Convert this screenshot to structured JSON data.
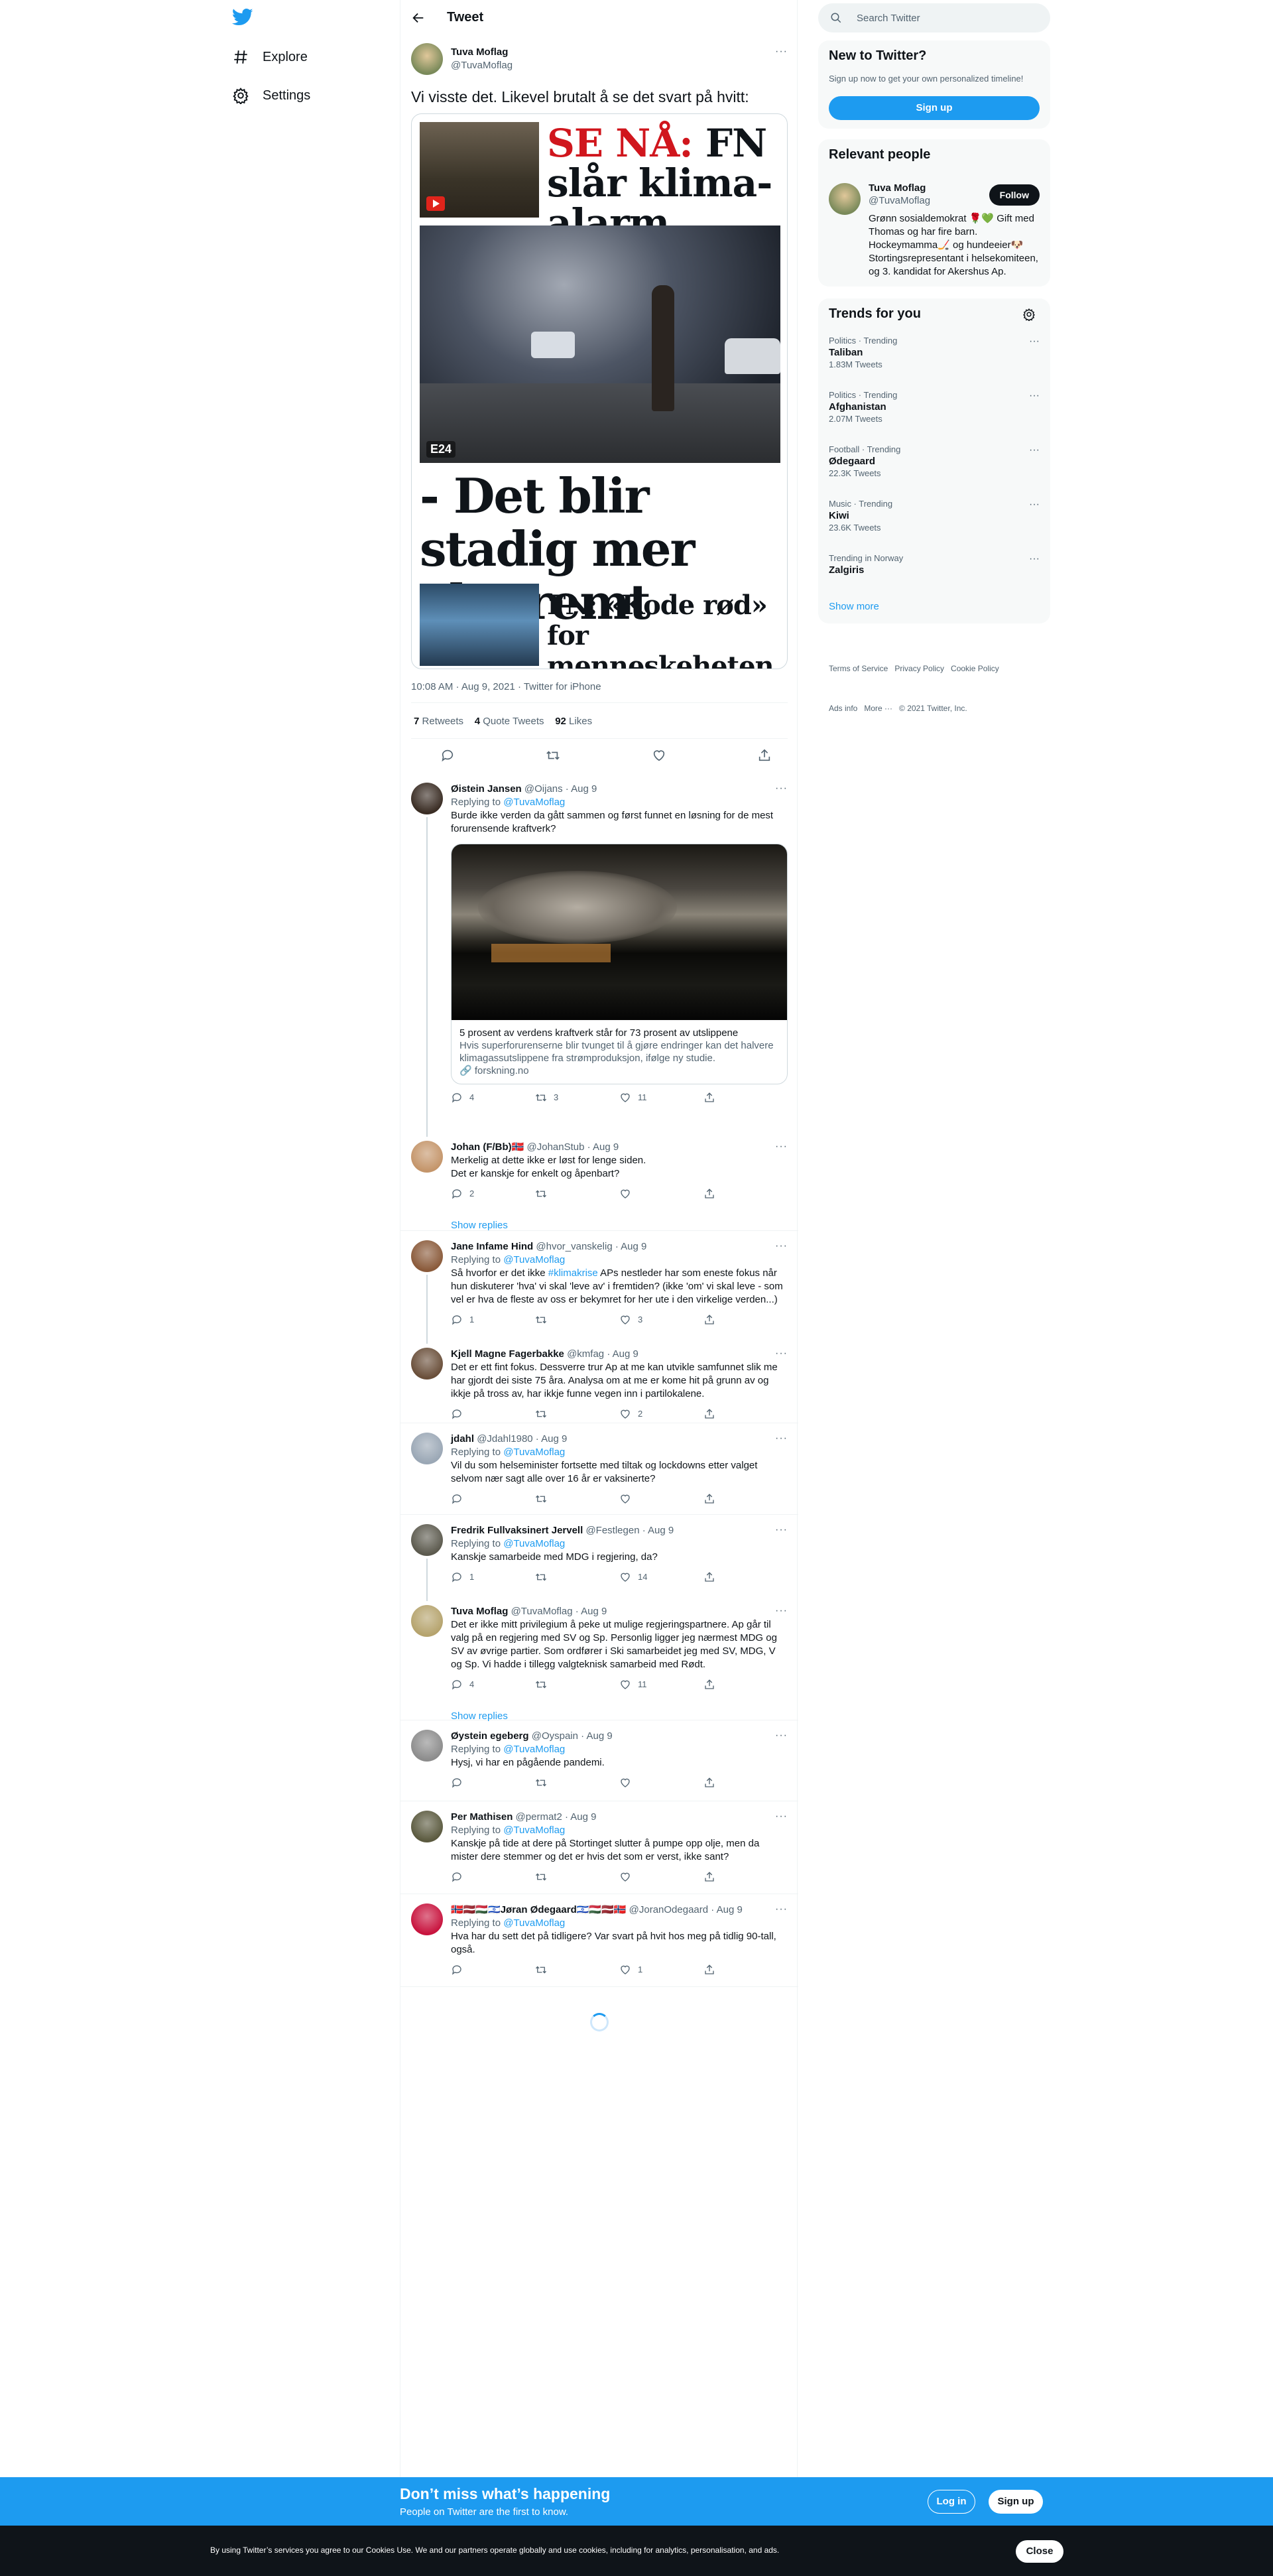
{
  "nav": {
    "explore": "Explore",
    "settings": "Settings"
  },
  "header": {
    "title": "Tweet"
  },
  "tweet": {
    "name": "Tuva Moflag",
    "handle": "@TuvaMoflag",
    "text": "Vi visste det. Likevel brutalt å se det svart på hvitt:",
    "headline1_red": "SE NÅ:",
    "headline1_rest": "FN slår klima-alarm",
    "badge": "E24",
    "headline2": "- Det blir stadig mer ekstremt",
    "headline3": "FN: «Kode rød» for menneskeheten",
    "meta": "10:08 AM · Aug 9, 2021 · Twitter for iPhone",
    "retweets": "7",
    "retweets_label": "Retweets",
    "quotes": "4",
    "quotes_label": "Quote Tweets",
    "likes": "92",
    "likes_label": "Likes"
  },
  "replies": [
    {
      "name": "Øistein Jansen",
      "handle": "@Oijans · Aug 9",
      "replying": "Replying to",
      "to": "@TuvaMoflag",
      "text": "Burde ikke verden da gått sammen og først funnet en løsning for de mest forurensende kraftverk?",
      "reply": "4",
      "rt": "3",
      "like": "11",
      "card": {
        "title": "5 prosent av verdens kraftverk står for 73 prosent av utslippene",
        "desc": "Hvis superforurenserne blir tvunget til å gjøre endringer kan det halvere klimagassutslippene fra strømproduksjon, ifølge ny studie.",
        "domain": "forskning.no"
      }
    },
    {
      "name": "Johan (F/Bb)🇳🇴",
      "handle": "@JohanStub · Aug 9",
      "text": "Merkelig at dette ikke er løst for lenge siden.\nDet er kanskje for enkelt og åpenbart?",
      "reply": "2",
      "rt": "",
      "like": "",
      "show": "Show replies"
    },
    {
      "name": "Jane Infame Hind",
      "handle": "@hvor_vanskelig · Aug 9",
      "replying": "Replying to",
      "to": "@TuvaMoflag",
      "text_a": "Så hvorfor er det ikke ",
      "tag": "#klimakrise",
      "text_b": " APs nestleder har som eneste fokus når hun diskuterer 'hva' vi skal 'leve av' i fremtiden? (ikke 'om' vi skal leve - som vel er hva de fleste av oss er bekymret for her ute i den virkelige verden...)",
      "reply": "1",
      "rt": "",
      "like": "3"
    },
    {
      "name": "Kjell Magne Fagerbakke",
      "handle": "@kmfag · Aug 9",
      "text": "Det er ett fint fokus. Dessverre trur Ap at me kan utvikle samfunnet slik me har gjordt dei siste 75 åra. Analysa om at me er kome hit på grunn av og ikkje på tross av, har ikkje funne vegen inn i partilokalene.",
      "reply": "",
      "rt": "",
      "like": "2"
    },
    {
      "name": "jdahl",
      "handle": "@Jdahl1980 · Aug 9",
      "replying": "Replying to",
      "to": "@TuvaMoflag",
      "text": "Vil du som helseminister fortsette med tiltak og lockdowns etter valget selvom nær sagt alle over 16 år er vaksinerte?",
      "reply": "",
      "rt": "",
      "like": ""
    },
    {
      "name": "Fredrik Fullvaksinert Jervell",
      "handle": "@Festlegen · Aug 9",
      "replying": "Replying to",
      "to": "@TuvaMoflag",
      "text": "Kanskje samarbeide med MDG i regjering, da?",
      "reply": "1",
      "rt": "",
      "like": "14"
    },
    {
      "name": "Tuva Moflag",
      "handle": "@TuvaMoflag · Aug 9",
      "text": "Det er ikke mitt privilegium å peke ut mulige regjeringspartnere. Ap går til valg på en regjering med SV og Sp. Personlig ligger jeg nærmest MDG og SV av øvrige partier. Som ordfører i Ski samarbeidet jeg med SV, MDG, V og Sp. Vi hadde i tillegg valgteknisk samarbeid med Rødt.",
      "reply": "4",
      "rt": "",
      "like": "11",
      "show": "Show replies"
    },
    {
      "name": "Øystein egeberg",
      "handle": "@Oyspain · Aug 9",
      "replying": "Replying to",
      "to": "@TuvaMoflag",
      "text": "Hysj, vi har en pågående pandemi.",
      "reply": "",
      "rt": "",
      "like": ""
    },
    {
      "name": "Per Mathisen",
      "handle": "@permat2 · Aug 9",
      "replying": "Replying to",
      "to": "@TuvaMoflag",
      "text": "Kanskje på tide at dere på Stortinget slutter å pumpe opp olje, men da mister dere stemmer og det er hvis det som er verst, ikke sant?",
      "reply": "",
      "rt": "",
      "like": ""
    },
    {
      "name": "🇳🇴🇱🇻🇭🇺🇮🇱Jøran Ødegaard🇮🇱🇭🇺🇱🇻🇳🇴",
      "handle": "@JoranOdegaard · Aug 9",
      "replying": "Replying to",
      "to": "@TuvaMoflag",
      "text": "Hva har du sett det på tidligere? Var svart på hvit hos meg på tidlig 90-tall, også.",
      "reply": "",
      "rt": "",
      "like": "1"
    }
  ],
  "search": {
    "placeholder": "Search Twitter"
  },
  "new": {
    "title": "New to Twitter?",
    "sub": "Sign up now to get your own personalized timeline!",
    "btn": "Sign up"
  },
  "relevant": {
    "title": "Relevant people",
    "name": "Tuva Moflag",
    "handle": "@TuvaMoflag",
    "follow": "Follow",
    "bio": "Grønn sosialdemokrat 🌹💚 Gift med Thomas og har fire barn. Hockeymamma🏒 og hundeeier🐶 Stortingsrepresentant i helsekomiteen, og 3. kandidat for Akershus Ap."
  },
  "trends": {
    "title": "Trends for you",
    "items": [
      {
        "c": "Politics · Trending",
        "t": "Taliban",
        "n": "1.83M Tweets"
      },
      {
        "c": "Politics · Trending",
        "t": "Afghanistan",
        "n": "2.07M Tweets"
      },
      {
        "c": "Football · Trending",
        "t": "Ødegaard",
        "n": "22.3K Tweets"
      },
      {
        "c": "Music · Trending",
        "t": "Kiwi",
        "n": "23.6K Tweets"
      },
      {
        "c": "Trending in Norway",
        "t": "Zalgiris",
        "n": ""
      }
    ],
    "more": "Show more"
  },
  "footer": {
    "l1": "Terms of Service   Privacy Policy   Cookie Policy",
    "l2": "Ads info   More ···   © 2021 Twitter, Inc."
  },
  "banner": {
    "title": "Don’t miss what’s happening",
    "sub": "People on Twitter are the first to know.",
    "login": "Log in",
    "signup": "Sign up"
  },
  "cookie": {
    "text": "By using Twitter’s services you agree to our Cookies Use. We and our partners operate globally and use cookies, including for analytics, personalisation, and ads.",
    "close": "Close"
  }
}
